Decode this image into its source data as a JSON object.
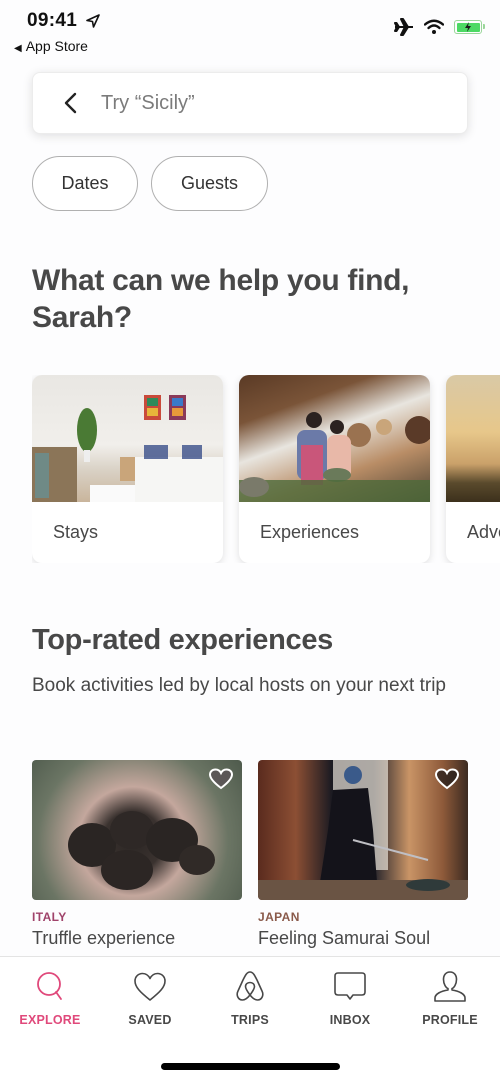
{
  "status_bar": {
    "time": "09:41",
    "back_app": "App Store",
    "icons": [
      "location-arrow-icon",
      "airplane-icon",
      "wifi-icon",
      "battery-charging-icon"
    ]
  },
  "search": {
    "back_icon": "chevron-left-icon",
    "placeholder": "Try “Sicily”",
    "value": ""
  },
  "filters": [
    {
      "label": "Dates"
    },
    {
      "label": "Guests"
    }
  ],
  "headline": "What can we help you find, Sarah?",
  "categories": [
    {
      "label": "Stays"
    },
    {
      "label": "Experiences"
    },
    {
      "label": "Adventures"
    }
  ],
  "top_rated": {
    "title": "Top-rated experiences",
    "subtitle": "Book activities led by local hosts on your next trip",
    "items": [
      {
        "country": "ITALY",
        "title": "Truffle experience",
        "country_color": "#a0436a"
      },
      {
        "country": "JAPAN",
        "title": "Feeling Samurai Soul",
        "country_color": "#8a5a4a"
      }
    ]
  },
  "tab_bar": {
    "accent": "#e0497b",
    "tabs": [
      {
        "label": "EXPLORE",
        "icon": "search-icon",
        "active": true
      },
      {
        "label": "SAVED",
        "icon": "heart-icon",
        "active": false
      },
      {
        "label": "TRIPS",
        "icon": "airbnb-belo-icon",
        "active": false
      },
      {
        "label": "INBOX",
        "icon": "chat-bubble-icon",
        "active": false
      },
      {
        "label": "PROFILE",
        "icon": "user-icon",
        "active": false
      }
    ]
  }
}
